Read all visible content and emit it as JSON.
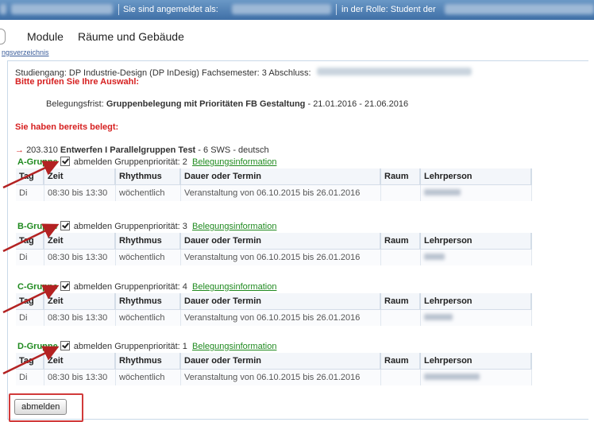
{
  "topbar": {
    "logged_in_label": "Sie sind angemeldet als:",
    "role_label": "in der Rolle: Student der"
  },
  "nav": {
    "tabs": [
      "Module",
      "Räume und Gebäude"
    ],
    "breadcrumb": "ngsverzeichnis"
  },
  "info": {
    "study_line": "Studiengang: DP Industrie-Design (DP InDesig) Fachsemester: 3 Abschluss:",
    "check_notice": "Bitte prüfen Sie Ihre Auswahl:",
    "deadline_label": "Belegungsfrist:",
    "deadline_value": "Gruppenbelegung mit Prioritäten FB Gestaltung",
    "deadline_dates": "- 21.01.2016 - 21.06.2016",
    "already_booked": "Sie haben bereits belegt:"
  },
  "course": {
    "arrow": "→",
    "number": "203.310",
    "title": "Entwerfen I Parallelgruppen Test",
    "sws": "- 6 SWS",
    "language": "- deutsch"
  },
  "table_headers": [
    "Tag",
    "Zeit",
    "Rhythmus",
    "Dauer oder Termin",
    "Raum",
    "Lehrperson"
  ],
  "groups": [
    {
      "name": "A-Gruppe",
      "deregister": "abmelden",
      "priority": "Gruppenpriorität: 2",
      "info_link": "Belegungsinformation",
      "row": {
        "tag": "Di",
        "zeit": "08:30 bis 13:30",
        "rhythmus": "wöchentlich",
        "dauer": "Veranstaltung von 06.10.2015  bis 26.01.2016",
        "raum": ""
      }
    },
    {
      "name": "B-Gruppe",
      "deregister": "abmelden",
      "priority": "Gruppenpriorität: 3",
      "info_link": "Belegungsinformation",
      "row": {
        "tag": "Di",
        "zeit": "08:30 bis 13:30",
        "rhythmus": "wöchentlich",
        "dauer": "Veranstaltung von 06.10.2015  bis 26.01.2016",
        "raum": ""
      }
    },
    {
      "name": "C-Gruppe",
      "deregister": "abmelden",
      "priority": "Gruppenpriorität: 4",
      "info_link": "Belegungsinformation",
      "row": {
        "tag": "Di",
        "zeit": "08:30 bis 13:30",
        "rhythmus": "wöchentlich",
        "dauer": "Veranstaltung von 06.10.2015  bis 26.01.2016",
        "raum": ""
      }
    },
    {
      "name": "D-Gruppe",
      "deregister": "abmelden",
      "priority": "Gruppenpriorität: 1",
      "info_link": "Belegungsinformation",
      "row": {
        "tag": "Di",
        "zeit": "08:30 bis 13:30",
        "rhythmus": "wöchentlich",
        "dauer": "Veranstaltung von 06.10.2015  bis 26.01.2016",
        "raum": ""
      }
    }
  ],
  "submit": {
    "label": "abmelden"
  },
  "colors": {
    "accent_red": "#d62020",
    "link_green": "#1f8a1f",
    "topbar": "#4a7ab0"
  }
}
